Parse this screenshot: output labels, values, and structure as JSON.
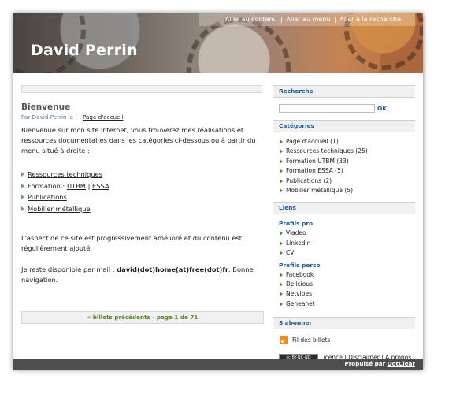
{
  "header": {
    "title": "David Perrin",
    "nav": [
      "Aller au contenu",
      "Aller au menu",
      "Aller à la recherche"
    ]
  },
  "post": {
    "title": "Bienvenue",
    "meta_prefix": "Par David Perrin le , -",
    "meta_link": "Page d'accueil",
    "intro": "Bienvenue sur mon site internet, vous trouverez mes réalisations et ressources documentaires dans les catégories ci-dessous ou à partir du menu situé à droite :",
    "links": {
      "ressources": "Ressources techniques",
      "formation_prefix": "Formation :",
      "utbm": "UTBM",
      "sep": "|",
      "essa": "ESSA",
      "publications": "Publications",
      "mobilier": "Mobilier métallique"
    },
    "aspect": "L'aspect de ce site est progressivement amélioré et du contenu est régulièrement ajouté.",
    "contact_prefix": "Je reste disponible par mail :",
    "contact_mail": "david(dot)home(at)free(dot)fr",
    "contact_suffix": ". Bonne navigation."
  },
  "pager": {
    "label": "« billets précédents - page 1 de 71"
  },
  "sidebar": {
    "search_title": "Recherche",
    "search_button": "OK",
    "categories_title": "Catégories",
    "categories": [
      "Page d'accueil (1)",
      "Ressources techniques (25)",
      "Formation UTBM (33)",
      "Formation ESSA (5)",
      "Publications (2)",
      "Mobilier métallique (5)"
    ],
    "liens_title": "Liens",
    "profils_pro_title": "Profils pro",
    "profils_pro": [
      "Viadeo",
      "LinkedIn",
      "CV"
    ],
    "profils_perso_title": "Profils perso",
    "profils_perso": [
      "Facebook",
      "Delicious",
      "Netvibes",
      "Geneanet"
    ],
    "abonner_title": "S'abonner",
    "rss_label": "Fil des billets",
    "cc_badge": "cc BY-NC-ND",
    "legal": "Licence | Disclaimer | A propos"
  },
  "footer": {
    "prefix": "Propulsé par",
    "link": "DotClear"
  }
}
